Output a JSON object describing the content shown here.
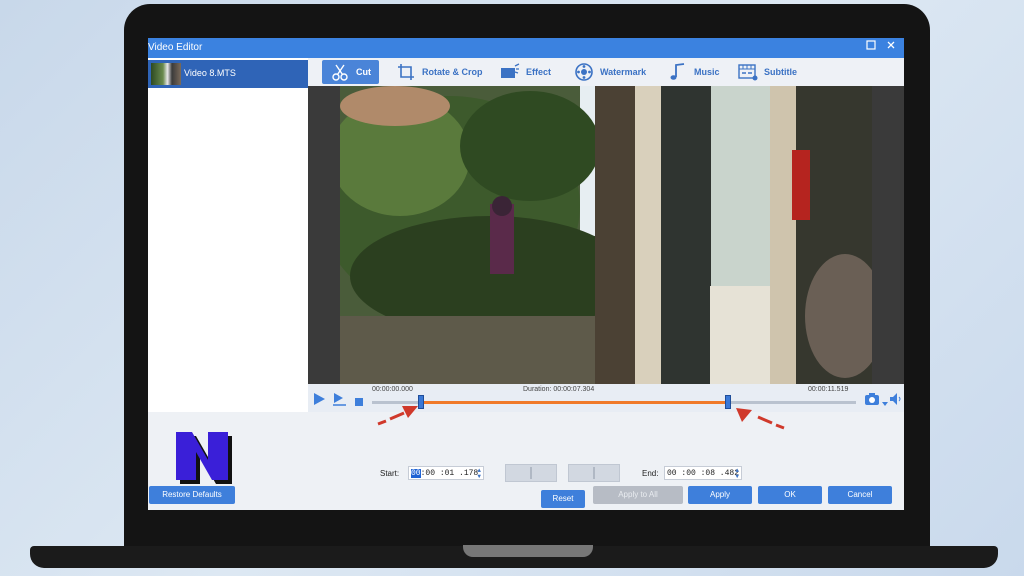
{
  "window": {
    "title": "Video Editor",
    "maximize_icon": "square-icon",
    "close_icon": "close-icon"
  },
  "sidebar": {
    "items": [
      {
        "label": "Video 8.MTS"
      }
    ]
  },
  "toolbar": {
    "tabs": [
      {
        "label": "Cut",
        "icon": "scissors-icon",
        "active": true
      },
      {
        "label": "Rotate & Crop",
        "icon": "crop-icon",
        "active": false
      },
      {
        "label": "Effect",
        "icon": "effect-icon",
        "active": false
      },
      {
        "label": "Watermark",
        "icon": "watermark-icon",
        "active": false
      },
      {
        "label": "Music",
        "icon": "music-note-icon",
        "active": false
      },
      {
        "label": "Subtitle",
        "icon": "subtitle-icon",
        "active": false
      }
    ]
  },
  "player": {
    "time_start": "00:00:00.000",
    "duration": "Duration: 00:00:07.304",
    "time_end": "00:00:11.519",
    "selection_start_fraction": 0.101,
    "selection_end_fraction": 0.736
  },
  "cut": {
    "start_label": "Start:",
    "start_selected": "00",
    "start_rest": ":00 :01 .178",
    "end_label": "End:",
    "end_value": "00 :00 :08 .482",
    "reset_label": "Reset"
  },
  "footer": {
    "restore_label": "Restore Defaults",
    "apply_all_label": "Apply to All",
    "apply_label": "Apply",
    "ok_label": "OK",
    "cancel_label": "Cancel"
  },
  "colors": {
    "accent": "#3e7fdb",
    "timeline_range": "#f07a2a",
    "logo": "#3a1fd8",
    "arrow": "#d0392b"
  }
}
